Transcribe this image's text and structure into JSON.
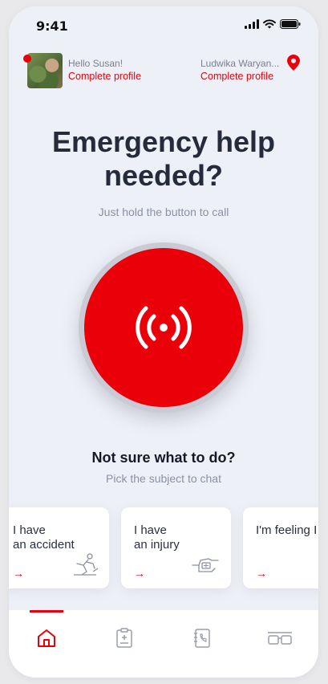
{
  "status_bar": {
    "time": "9:41"
  },
  "profile": {
    "greeting": "Hello Susan!",
    "complete_label": "Complete profile"
  },
  "location": {
    "name": "Ludwika Waryan...",
    "complete_label": "Complete profile"
  },
  "hero": {
    "title": "Emergency help needed?",
    "subtitle": "Just hold the button to call"
  },
  "help": {
    "title": "Not sure what to do?",
    "subtitle": "Pick the subject to chat"
  },
  "cards": [
    {
      "line1": "I have",
      "line2": "an accident",
      "arrow": "→",
      "icon": "accident-icon"
    },
    {
      "line1": "I have",
      "line2": "an injury",
      "arrow": "→",
      "icon": "injury-icon"
    },
    {
      "line1": "I'm feeling I",
      "line2": "",
      "arrow": "→",
      "icon": ""
    }
  ],
  "tabs": [
    {
      "icon": "home-icon",
      "active": true
    },
    {
      "icon": "medical-report-icon",
      "active": false
    },
    {
      "icon": "phone-book-icon",
      "active": false
    },
    {
      "icon": "glasses-icon",
      "active": false
    }
  ],
  "colors": {
    "accent": "#e8000b",
    "title": "#262b3c",
    "muted": "#8c90a0",
    "background": "#eef0f8"
  }
}
